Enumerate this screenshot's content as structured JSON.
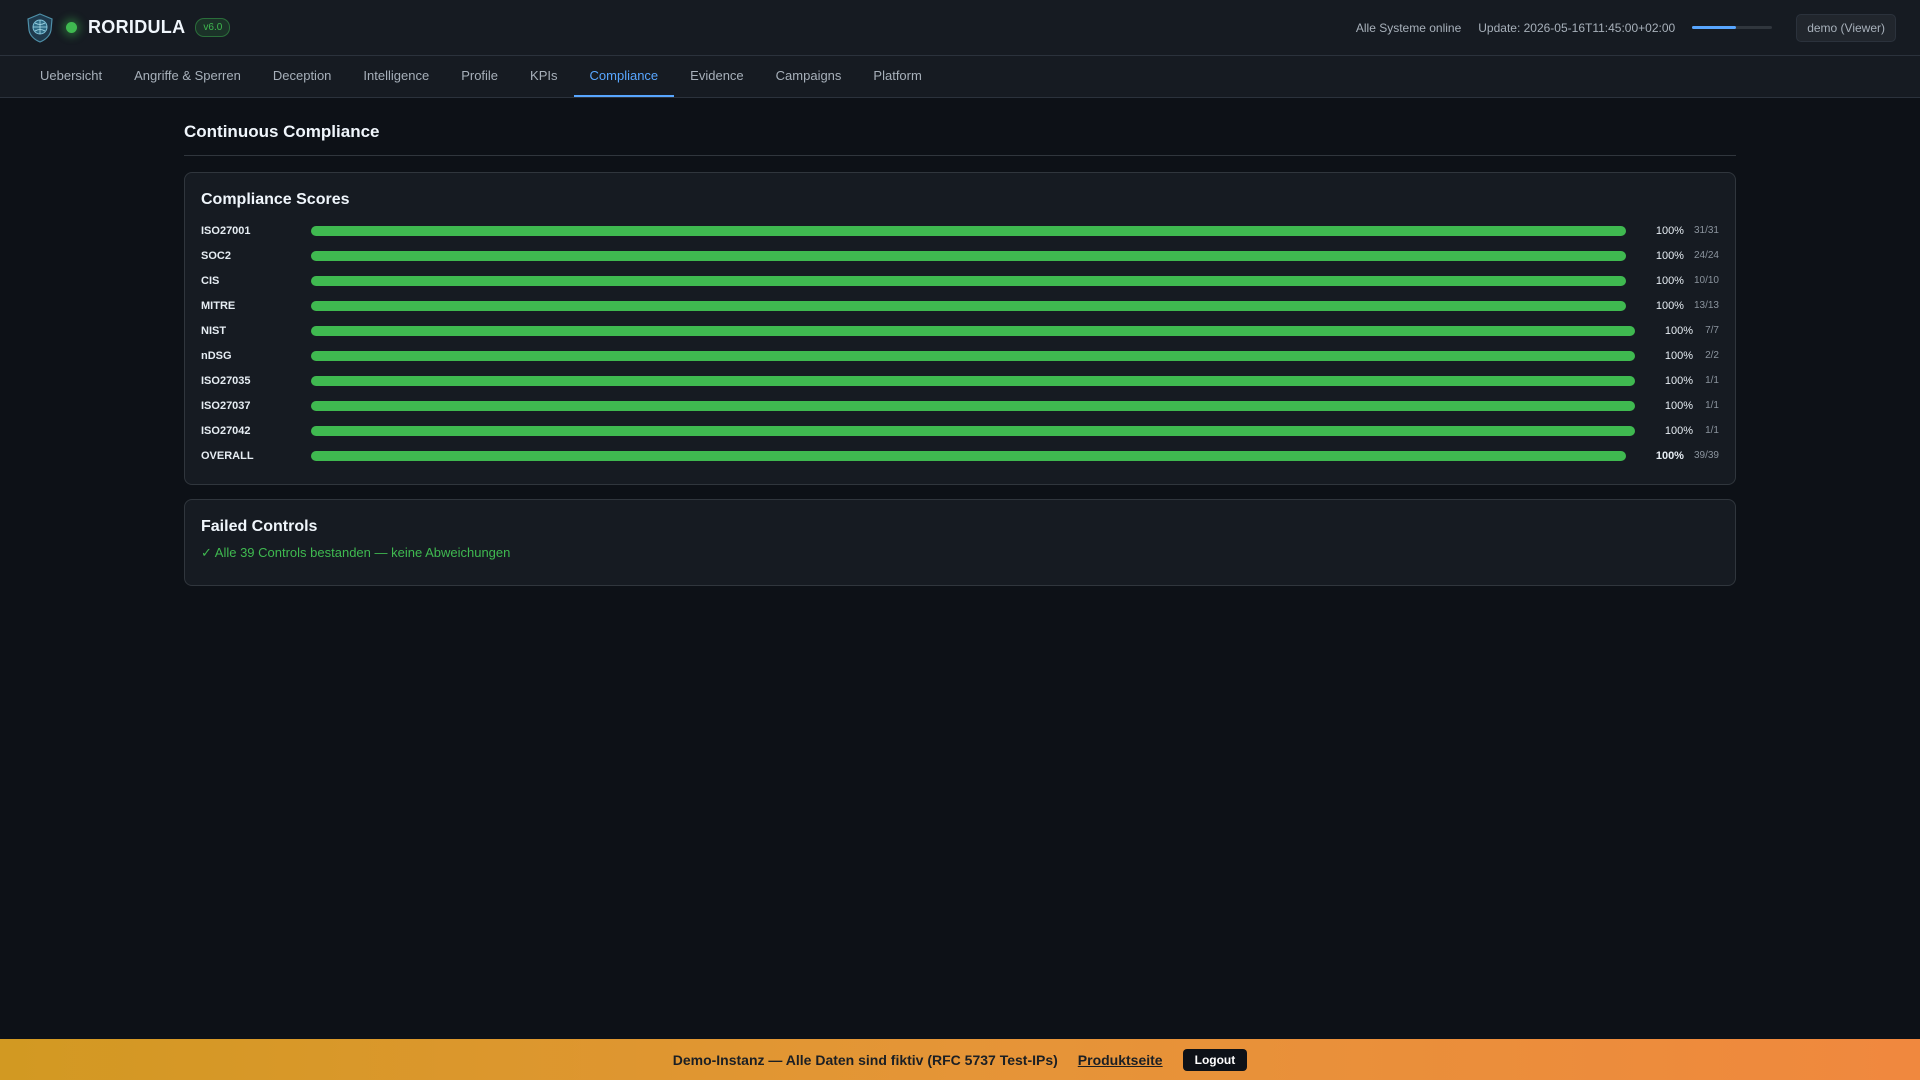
{
  "header": {
    "brand": "RORIDULA",
    "version": "v6.0",
    "system_status": "Alle Systeme online",
    "update": "Update: 2026-05-16T11:45:00+02:00",
    "refresh_progress": 0.55,
    "user": "demo (Viewer)"
  },
  "nav": {
    "tabs": [
      "Uebersicht",
      "Angriffe & Sperren",
      "Deception",
      "Intelligence",
      "Profile",
      "KPIs",
      "Compliance",
      "Evidence",
      "Campaigns",
      "Platform"
    ],
    "active": "Compliance"
  },
  "page": {
    "title": "Continuous Compliance"
  },
  "scores": {
    "title": "Compliance Scores",
    "rows": [
      {
        "name": "ISO27001",
        "percent": 100,
        "pct_label": "100%",
        "count": "31/31"
      },
      {
        "name": "SOC2",
        "percent": 100,
        "pct_label": "100%",
        "count": "24/24"
      },
      {
        "name": "CIS",
        "percent": 100,
        "pct_label": "100%",
        "count": "10/10"
      },
      {
        "name": "MITRE",
        "percent": 100,
        "pct_label": "100%",
        "count": "13/13"
      },
      {
        "name": "NIST",
        "percent": 100,
        "pct_label": "100%",
        "count": "7/7"
      },
      {
        "name": "nDSG",
        "percent": 100,
        "pct_label": "100%",
        "count": "2/2"
      },
      {
        "name": "ISO27035",
        "percent": 100,
        "pct_label": "100%",
        "count": "1/1"
      },
      {
        "name": "ISO27037",
        "percent": 100,
        "pct_label": "100%",
        "count": "1/1"
      },
      {
        "name": "ISO27042",
        "percent": 100,
        "pct_label": "100%",
        "count": "1/1"
      },
      {
        "name": "OVERALL",
        "percent": 100,
        "pct_label": "100%",
        "count": "39/39"
      }
    ]
  },
  "failed": {
    "title": "Failed Controls",
    "message": "✓ Alle 39 Controls bestanden — keine Abweichungen"
  },
  "banner": {
    "text": "Demo-Instanz — Alle Daten sind fiktiv (RFC 5737 Test-IPs)",
    "link": "Produktseite",
    "logout": "Logout"
  },
  "colors": {
    "accent": "#58a6ff",
    "success": "#3fb950",
    "background": "#0d1117",
    "panel": "#161b22",
    "banner_start": "#d29922",
    "banner_end": "#f0883e"
  },
  "icons": {
    "logo": "shield-globe-logo-icon",
    "status": "online-status-dot-icon"
  }
}
